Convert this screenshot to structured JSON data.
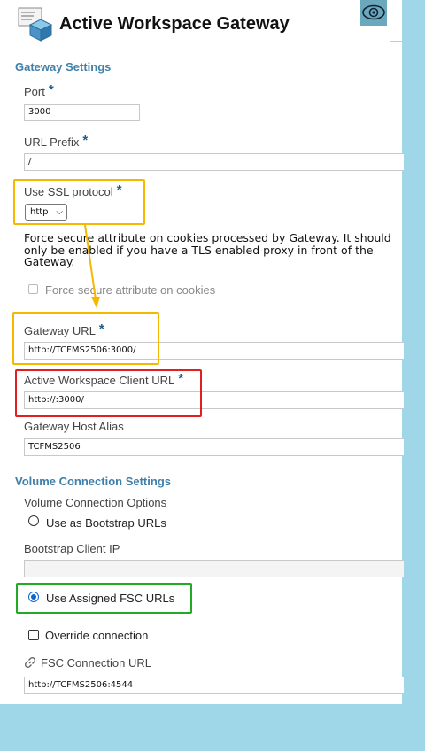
{
  "header": {
    "title": "Active Workspace Gateway",
    "eye_icon": "eye-icon",
    "app_icon": "gateway-cube-icon"
  },
  "gateway_settings": {
    "heading": "Gateway Settings",
    "port": {
      "label": "Port",
      "required": "*",
      "value": "3000"
    },
    "url_prefix": {
      "label": "URL Prefix",
      "required": "*",
      "value": "/"
    },
    "ssl": {
      "label": "Use SSL protocol",
      "required": "*",
      "value": "http"
    },
    "secure_cookie_desc": "Force secure attribute on cookies processed by Gateway. It should only be enabled if you have a TLS enabled proxy in front of the Gateway.",
    "secure_cookie_checkbox": "Force secure attribute on cookies",
    "gateway_url": {
      "label": "Gateway URL",
      "required": "*",
      "value": "http://TCFMS2506:3000/"
    },
    "client_url": {
      "label": "Active Workspace Client URL",
      "required": "*",
      "value": "http://:3000/"
    },
    "host_alias": {
      "label": "Gateway Host Alias",
      "value": "TCFMS2506"
    }
  },
  "volume_settings": {
    "heading": "Volume Connection Settings",
    "options_label": "Volume Connection Options",
    "bootstrap_option": "Use as Bootstrap URLs",
    "bootstrap_ip_label": "Bootstrap Client IP",
    "bootstrap_ip_value": "",
    "assigned_option": "Use Assigned FSC URLs",
    "override_label": "Override connection",
    "fsc_url": {
      "label": "FSC Connection URL",
      "value": "http://TCFMS2506:4544"
    }
  },
  "colors": {
    "yellow": "#f5b800",
    "red": "#e02020",
    "green": "#22aa22",
    "heading": "#3f7fa8",
    "background": "#9fd7e8"
  }
}
